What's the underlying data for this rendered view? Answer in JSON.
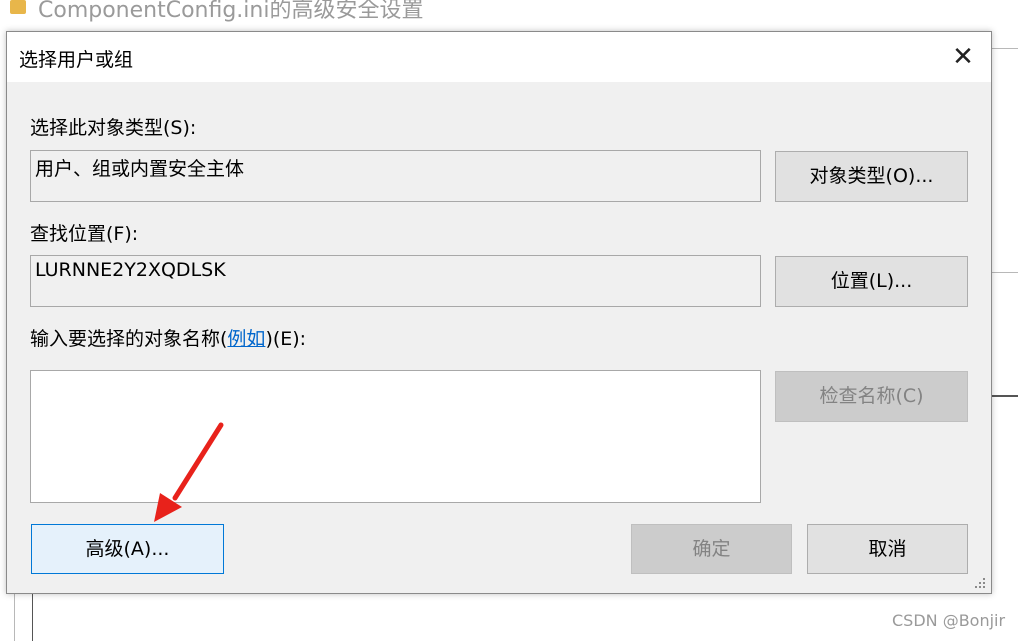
{
  "background_window": {
    "title": "ComponentConfig.ini的高级安全设置"
  },
  "dialog": {
    "title": "选择用户或组",
    "object_type_label": "选择此对象类型(S):",
    "object_type_value": "用户、组或内置安全主体",
    "object_types_button": "对象类型(O)...",
    "location_label": "查找位置(F):",
    "location_value": "LURNNE2Y2XQDLSK",
    "location_button": "位置(L)...",
    "names_label_prefix": "输入要选择的对象名称(",
    "names_label_link": "例如",
    "names_label_suffix": ")(E):",
    "names_input_value": "",
    "check_names_button": "检查名称(C)",
    "advanced_button": "高级(A)...",
    "ok_button": "确定",
    "cancel_button": "取消",
    "close_symbol": "✕"
  },
  "annotation": {
    "arrow_color": "#e8221b"
  },
  "watermark": "CSDN @Bonjir"
}
